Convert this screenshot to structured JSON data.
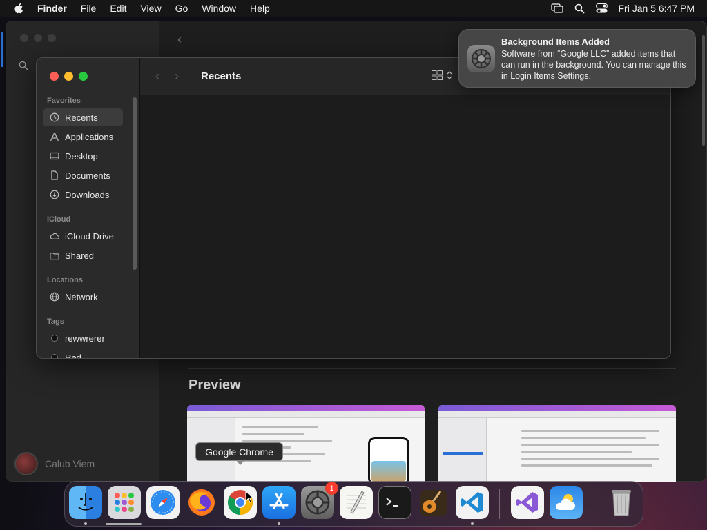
{
  "menubar": {
    "app": "Finder",
    "items": [
      "File",
      "Edit",
      "View",
      "Go",
      "Window",
      "Help"
    ],
    "clock": "Fri Jan 5  6:47 PM",
    "status_icons": [
      "screen-mirroring-icon",
      "spotlight-search-icon",
      "control-center-icon"
    ]
  },
  "background_window": {
    "user_name": "Calub Viem",
    "preview_title": "Preview"
  },
  "finder": {
    "title": "Recents",
    "sidebar": {
      "favorites_header": "Favorites",
      "favorites": [
        {
          "label": "Recents",
          "icon": "clock-icon",
          "active": true
        },
        {
          "label": "Applications",
          "icon": "applications-icon",
          "active": false
        },
        {
          "label": "Desktop",
          "icon": "desktop-icon",
          "active": false
        },
        {
          "label": "Documents",
          "icon": "document-icon",
          "active": false
        },
        {
          "label": "Downloads",
          "icon": "download-icon",
          "active": false
        }
      ],
      "icloud_header": "iCloud",
      "icloud": [
        {
          "label": "iCloud Drive",
          "icon": "cloud-icon"
        },
        {
          "label": "Shared",
          "icon": "shared-folder-icon"
        }
      ],
      "locations_header": "Locations",
      "locations": [
        {
          "label": "Network",
          "icon": "network-icon"
        }
      ],
      "tags_header": "Tags",
      "tags": [
        {
          "label": "rewwrerer",
          "color": "#111111"
        },
        {
          "label": "Red",
          "color": "#111111"
        }
      ]
    }
  },
  "notification": {
    "title": "Background Items Added",
    "body": "Software from “Google LLC” added items that can run in the background. You can manage this in Login Items Settings.",
    "icon": "system-settings-gear-icon"
  },
  "dock": {
    "tooltip": "Google Chrome",
    "apps": [
      {
        "name": "finder",
        "icon": "finder-icon",
        "running": true
      },
      {
        "name": "launchpad",
        "icon": "launchpad-icon",
        "running": false
      },
      {
        "name": "safari",
        "icon": "safari-icon",
        "running": false
      },
      {
        "name": "firefox",
        "icon": "firefox-icon",
        "running": false
      },
      {
        "name": "chrome",
        "icon": "chrome-icon",
        "running": false
      },
      {
        "name": "app-store",
        "icon": "app-store-icon",
        "running": true
      },
      {
        "name": "system-settings",
        "icon": "system-settings-icon",
        "running": false,
        "badge": "1"
      },
      {
        "name": "textedit",
        "icon": "textedit-icon",
        "running": false
      },
      {
        "name": "terminal",
        "icon": "terminal-icon",
        "running": false
      },
      {
        "name": "garageband",
        "icon": "garageband-icon",
        "running": false
      },
      {
        "name": "vscode",
        "icon": "vscode-icon",
        "running": true
      },
      {
        "name": "visual-studio",
        "icon": "visual-studio-icon",
        "running": false
      },
      {
        "name": "weather",
        "icon": "weather-icon",
        "running": false
      },
      {
        "name": "trash",
        "icon": "trash-icon",
        "running": false
      }
    ]
  }
}
